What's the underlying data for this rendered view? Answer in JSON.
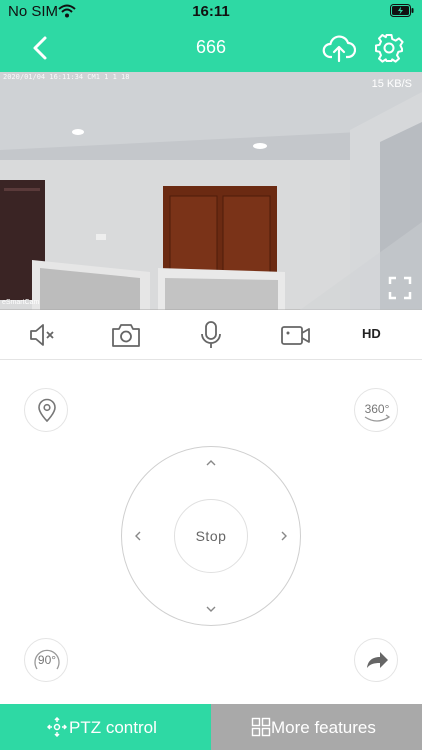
{
  "status_bar": {
    "carrier": "No SIM",
    "time": "16:11"
  },
  "nav": {
    "title": "666"
  },
  "video": {
    "timestamp": "2020/01/04 16:11:34 CM1 1 1 18",
    "speed": "15 KB/S",
    "watermark": "eSmartCam"
  },
  "toolbar": {
    "items": [
      "mute-icon",
      "camera-icon",
      "microphone-icon",
      "video-record-icon"
    ],
    "quality": "HD"
  },
  "ptz": {
    "location_icon": "location-pin-icon",
    "rotate360_label": "360°",
    "rotate90_label": "90°",
    "share_icon": "share-arrow-icon",
    "stop_label": "Stop",
    "up": "^",
    "down": "v",
    "left": "<",
    "right": ">"
  },
  "tabs": {
    "ptz_label": "PTZ control",
    "more_label": "More features"
  },
  "colors": {
    "accent": "#2ed9a4",
    "inactive_tab": "#a9a9a9"
  }
}
